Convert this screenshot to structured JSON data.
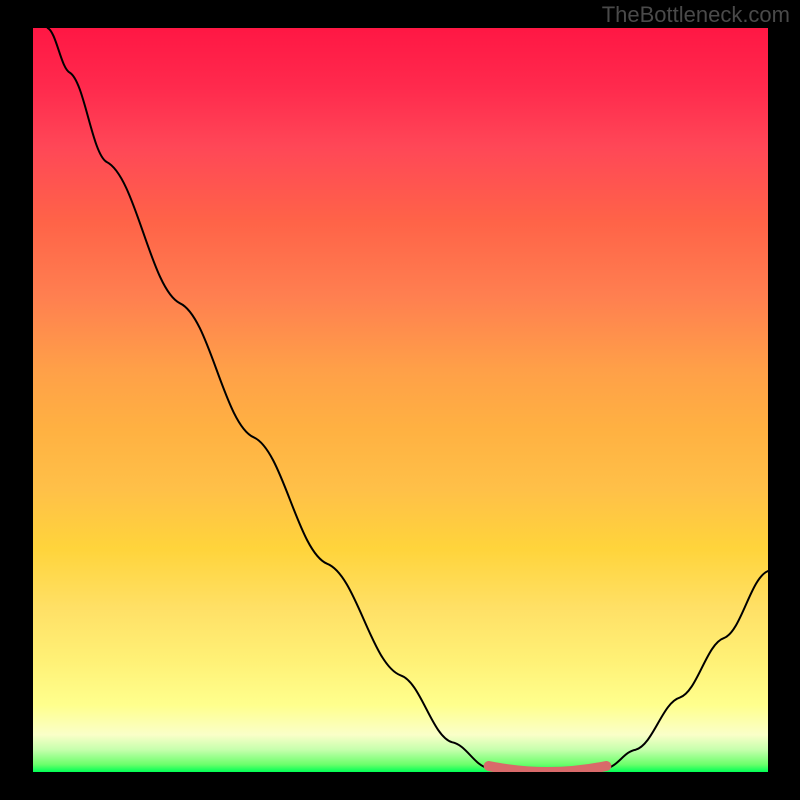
{
  "watermark": "TheBottleneck.com",
  "chart_data": {
    "type": "line",
    "title": "",
    "xlabel": "",
    "ylabel": "",
    "xlim": [
      0,
      100
    ],
    "ylim": [
      0,
      100
    ],
    "curve": {
      "name": "bottleneck-curve",
      "color": "#000000",
      "points": [
        {
          "x": 2,
          "y": 100
        },
        {
          "x": 5,
          "y": 94
        },
        {
          "x": 10,
          "y": 82
        },
        {
          "x": 20,
          "y": 63
        },
        {
          "x": 30,
          "y": 45
        },
        {
          "x": 40,
          "y": 28
        },
        {
          "x": 50,
          "y": 13
        },
        {
          "x": 57,
          "y": 4
        },
        {
          "x": 62,
          "y": 0.5
        },
        {
          "x": 70,
          "y": 0
        },
        {
          "x": 78,
          "y": 0.5
        },
        {
          "x": 82,
          "y": 3
        },
        {
          "x": 88,
          "y": 10
        },
        {
          "x": 94,
          "y": 18
        },
        {
          "x": 100,
          "y": 27
        }
      ]
    },
    "sweet_spot": {
      "name": "optimal-range-marker",
      "color": "#d96a6a",
      "x_start": 62,
      "x_end": 78,
      "y": 0.4
    },
    "gradient_stops": [
      {
        "pos": 0,
        "color": "#ff1744"
      },
      {
        "pos": 50,
        "color": "#ffb142"
      },
      {
        "pos": 90,
        "color": "#ffff8d"
      },
      {
        "pos": 100,
        "color": "#00ff55"
      }
    ]
  }
}
